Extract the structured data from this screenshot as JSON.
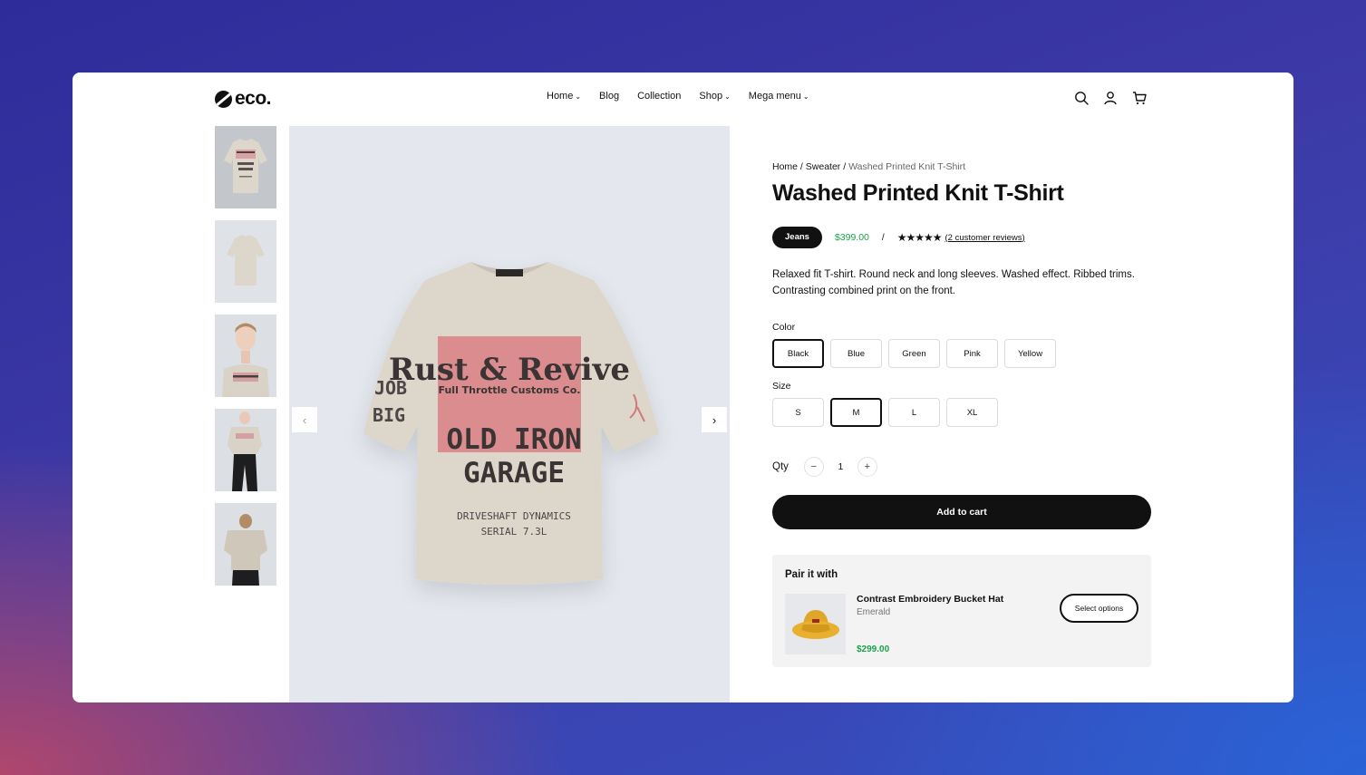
{
  "header": {
    "logo": "eco.",
    "nav": [
      {
        "label": "Home",
        "dropdown": true
      },
      {
        "label": "Blog",
        "dropdown": false
      },
      {
        "label": "Collection",
        "dropdown": false
      },
      {
        "label": "Shop",
        "dropdown": true
      },
      {
        "label": "Mega menu",
        "dropdown": true
      }
    ],
    "icons": [
      "search-icon",
      "user-icon",
      "cart-icon"
    ]
  },
  "gallery": {
    "thumbnail_count": 5,
    "prev_arrow": "‹",
    "next_arrow": "›"
  },
  "breadcrumb": {
    "home": "Home",
    "separator": " / ",
    "category": "Sweater",
    "current": "Washed Printed Knit T-Shirt"
  },
  "product": {
    "title": "Washed Printed Knit T-Shirt",
    "badge": "Jeans",
    "price": "$399.00",
    "separator": "/",
    "stars": "★★★★★",
    "reviews": "(2 customer reviews)",
    "description": "Relaxed fit T-shirt. Round neck and long sleeves. Washed effect. Ribbed trims. Contrasting combined print on the front.",
    "print_text": {
      "line1": "Rust & Revive",
      "line2": "Full Throttle Customs Co.",
      "line3": "OLD IRON",
      "line4": "GARAGE",
      "line5": "DRIVESHAFT DYNAMICS",
      "line6": "SERIAL 7.3L",
      "sleeve1": "JOB",
      "sleeve2": "BIG"
    }
  },
  "options": {
    "color_label": "Color",
    "colors": [
      "Black",
      "Blue",
      "Green",
      "Pink",
      "Yellow"
    ],
    "selected_color": "Black",
    "size_label": "Size",
    "sizes": [
      "S",
      "M",
      "L",
      "XL"
    ],
    "selected_size": "M"
  },
  "quantity": {
    "label": "Qty",
    "minus": "−",
    "value": "1",
    "plus": "+"
  },
  "cart": {
    "add_label": "Add to cart"
  },
  "pair": {
    "title": "Pair it with",
    "name": "Contrast Embroidery Bucket Hat",
    "variant": "Emerald",
    "price": "$299.00",
    "button": "Select options"
  },
  "colors": {
    "price_green": "#1aa34a",
    "button_black": "#111111",
    "image_bg": "#e4e8ee",
    "print_red": "#d9737a"
  }
}
